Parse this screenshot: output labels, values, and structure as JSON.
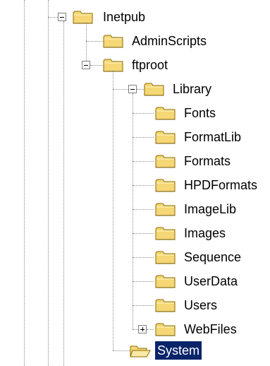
{
  "tree": {
    "root": {
      "label": "Inetpub",
      "state": "expanded",
      "icon": "folder-icon"
    },
    "inetpub_children": [
      {
        "label": "AdminScripts",
        "icon": "folder-icon"
      },
      {
        "label": "ftproot",
        "state": "expanded",
        "icon": "folder-icon"
      }
    ],
    "ftproot_children": [
      {
        "label": "Library",
        "state": "expanded",
        "icon": "folder-icon"
      }
    ],
    "library_children": [
      {
        "label": "Fonts",
        "icon": "folder-icon"
      },
      {
        "label": "FormatLib",
        "icon": "folder-icon"
      },
      {
        "label": "Formats",
        "icon": "folder-icon"
      },
      {
        "label": "HPDFormats",
        "icon": "folder-icon"
      },
      {
        "label": "ImageLib",
        "icon": "folder-icon"
      },
      {
        "label": "Images",
        "icon": "folder-icon"
      },
      {
        "label": "Sequence",
        "icon": "folder-icon"
      },
      {
        "label": "UserData",
        "icon": "folder-icon"
      },
      {
        "label": "Users",
        "icon": "folder-icon"
      },
      {
        "label": "WebFiles",
        "state": "collapsed",
        "icon": "folder-icon"
      }
    ],
    "system": {
      "label": "System",
      "selected": true,
      "icon": "open-folder-icon"
    }
  },
  "colors": {
    "selection_bg": "#0a246a",
    "selection_text": "#ffffff",
    "folder_fill": "#f5d775",
    "folder_outline": "#8a6d00",
    "dotted_line": "#8a8a8a"
  }
}
